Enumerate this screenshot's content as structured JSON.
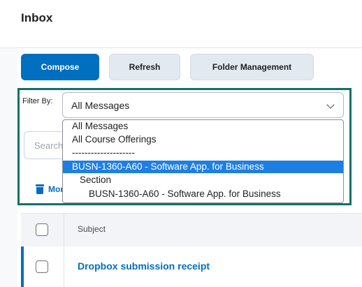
{
  "page": {
    "title": "Inbox"
  },
  "toolbar": {
    "compose_label": "Compose",
    "refresh_label": "Refresh",
    "folder_management_label": "Folder Management"
  },
  "filter": {
    "label": "Filter By:",
    "selected": "All Messages",
    "options": [
      "All Messages",
      "All Course Offerings",
      "--------------------",
      "BUSN-1360-A60 - Software App. for Business",
      "Section",
      "BUSN-1360-A60 - Software App. for Business"
    ],
    "highlighted_index": 3
  },
  "search": {
    "placeholder": "Search"
  },
  "bulk_actions": {
    "more_label": "More"
  },
  "table": {
    "columns": [
      "Subject"
    ],
    "rows": [
      {
        "subject": "Dropbox submission receipt"
      }
    ]
  },
  "colors": {
    "accent": "#006fbf",
    "focus_outline": "#11706a",
    "dropdown_highlight": "#1e7fe3"
  },
  "icons": {
    "chevron": "chevron-down-icon",
    "delete": "trash-icon"
  }
}
